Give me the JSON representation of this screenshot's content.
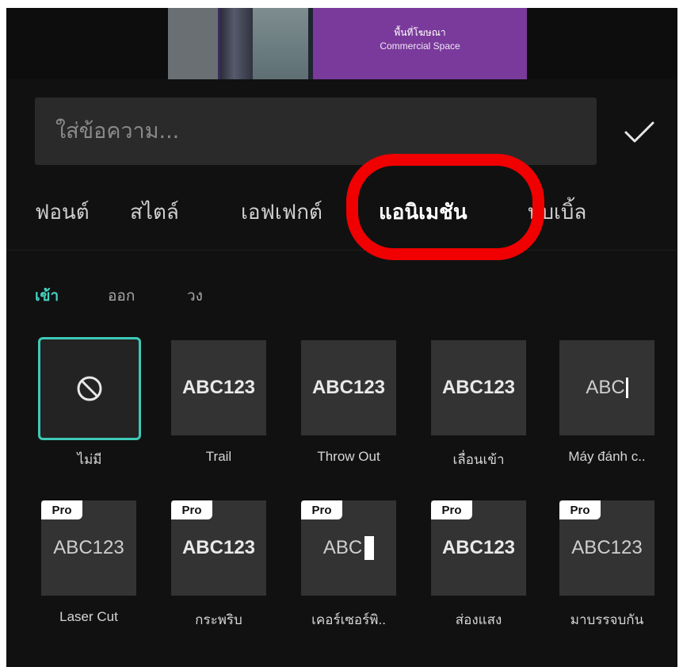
{
  "preview": {
    "sign_thai": "พื้นที่โฆษณา",
    "sign_english": "Commercial Space"
  },
  "text_input": {
    "placeholder": "ใส่ข้อความ..."
  },
  "main_tabs": [
    {
      "label": "ฟอนต์",
      "active": false
    },
    {
      "label": "สไตล์",
      "active": false
    },
    {
      "label": "เอฟเฟกต์",
      "active": false
    },
    {
      "label": "แอนิเมชัน",
      "active": true
    },
    {
      "label": "บับเบิ้ล",
      "active": false
    }
  ],
  "sub_tabs": [
    {
      "label": "เข้า",
      "active": true
    },
    {
      "label": "ออก",
      "active": false
    },
    {
      "label": "วง",
      "active": false
    }
  ],
  "animations_row1": [
    {
      "preview": "",
      "label": "ไม่มี",
      "icon": "none-icon",
      "selected": true
    },
    {
      "preview": "ABC123",
      "label": "Trail"
    },
    {
      "preview": "ABC123",
      "label": "Throw Out"
    },
    {
      "preview": "ABC123",
      "label": "เลื่อนเข้า"
    },
    {
      "preview": "ABC",
      "label": "Máy đánh c.."
    }
  ],
  "animations_row2": [
    {
      "preview": "ABC123",
      "label": "Laser Cut",
      "badge": "Pro"
    },
    {
      "preview": "ABC123",
      "label": "กระพริบ",
      "badge": "Pro"
    },
    {
      "preview": "ABC",
      "label": "เคอร์เซอร์พิ..",
      "badge": "Pro"
    },
    {
      "preview": "ABC123",
      "label": "ส่องแสง",
      "badge": "Pro"
    },
    {
      "preview": "ABC123",
      "label": "มาบรรจบกัน",
      "badge": "Pro"
    }
  ],
  "colors": {
    "background": "#111111",
    "accent_teal": "#43d3c3",
    "annotation_red": "#f00000"
  }
}
